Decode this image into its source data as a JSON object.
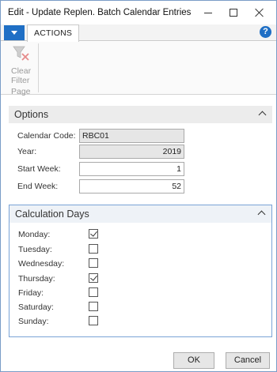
{
  "window": {
    "title": "Edit - Update Replen. Batch Calendar Entries"
  },
  "ribbon": {
    "tab": "ACTIONS",
    "help_glyph": "?",
    "clear_filter_line1": "Clear",
    "clear_filter_line2": "Filter",
    "group_label": "Page"
  },
  "options": {
    "header": "Options",
    "fields": [
      {
        "label": "Calendar Code:",
        "value": "RBC01"
      },
      {
        "label": "Year:",
        "value": "2019"
      },
      {
        "label": "Start Week:",
        "value": "1"
      },
      {
        "label": "End Week:",
        "value": "52"
      }
    ]
  },
  "calculation_days": {
    "header": "Calculation Days",
    "days": [
      {
        "label": "Monday:",
        "checked": true
      },
      {
        "label": "Tuesday:",
        "checked": false
      },
      {
        "label": "Wednesday:",
        "checked": false
      },
      {
        "label": "Thursday:",
        "checked": true
      },
      {
        "label": "Friday:",
        "checked": false
      },
      {
        "label": "Saturday:",
        "checked": false
      },
      {
        "label": "Sunday:",
        "checked": false
      }
    ]
  },
  "buttons": {
    "ok": "OK",
    "cancel": "Cancel"
  },
  "colors": {
    "accent": "#1f6fc5",
    "readonly_field": "#e6e6e6"
  },
  "icons": [
    "app-menu-icon",
    "help-icon",
    "clear-filter-icon",
    "minimize-icon",
    "maximize-icon",
    "close-icon",
    "chevron-up-icon"
  ]
}
